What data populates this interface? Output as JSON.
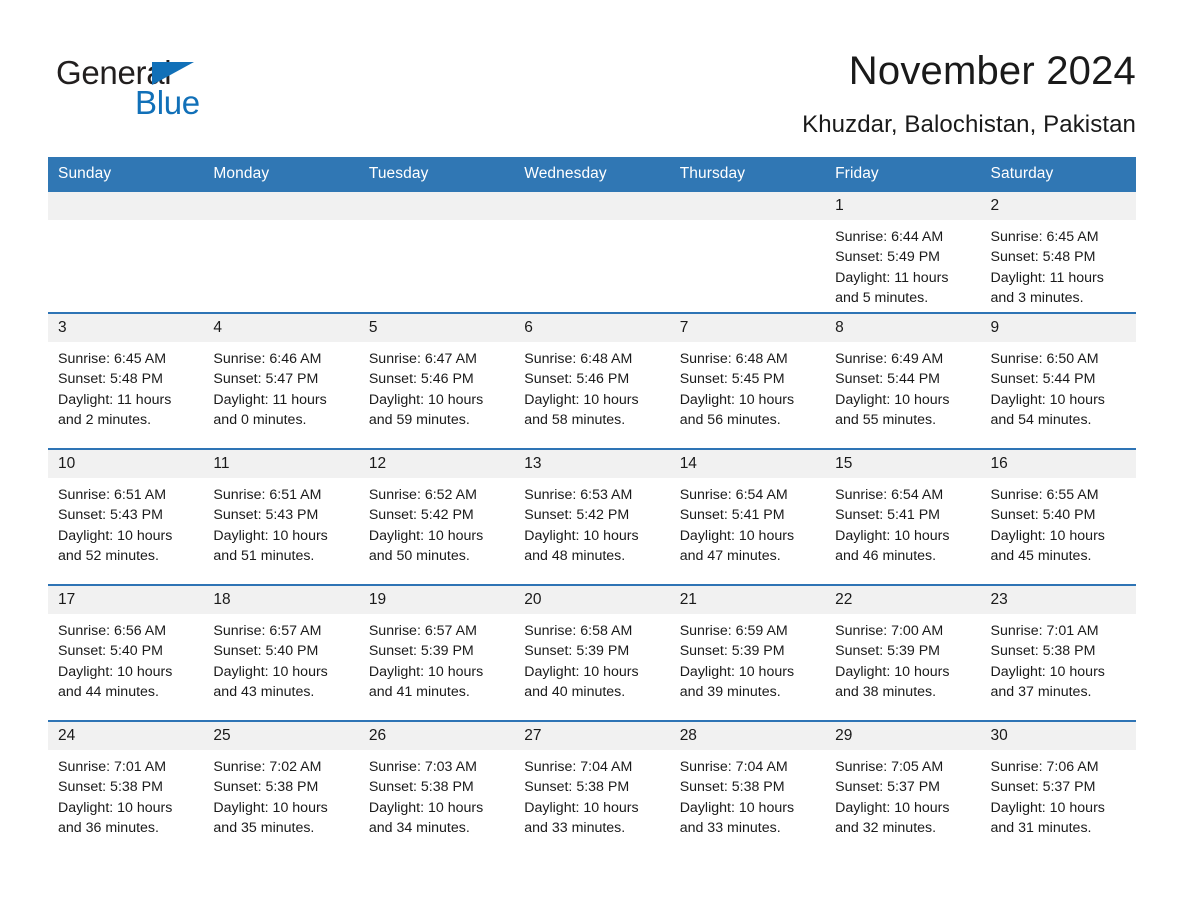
{
  "brand": {
    "name_part1": "General",
    "name_part2": "Blue",
    "accent_color": "#1170b8"
  },
  "header": {
    "title": "November 2024",
    "location": "Khuzdar, Balochistan, Pakistan"
  },
  "theme": {
    "header_blue": "#3077b4",
    "row_divider_blue": "#2e74b5",
    "daynum_band": "#f1f1f1"
  },
  "weekday_headers": [
    "Sunday",
    "Monday",
    "Tuesday",
    "Wednesday",
    "Thursday",
    "Friday",
    "Saturday"
  ],
  "labels": {
    "sunrise_prefix": "Sunrise:",
    "sunset_prefix": "Sunset:",
    "daylight_prefix": "Daylight:"
  },
  "weeks": [
    [
      {
        "date": "",
        "empty": true
      },
      {
        "date": "",
        "empty": true
      },
      {
        "date": "",
        "empty": true
      },
      {
        "date": "",
        "empty": true
      },
      {
        "date": "",
        "empty": true
      },
      {
        "date": "1",
        "sunrise": "Sunrise: 6:44 AM",
        "sunset": "Sunset: 5:49 PM",
        "daylight": "Daylight: 11 hours and 5 minutes."
      },
      {
        "date": "2",
        "sunrise": "Sunrise: 6:45 AM",
        "sunset": "Sunset: 5:48 PM",
        "daylight": "Daylight: 11 hours and 3 minutes."
      }
    ],
    [
      {
        "date": "3",
        "sunrise": "Sunrise: 6:45 AM",
        "sunset": "Sunset: 5:48 PM",
        "daylight": "Daylight: 11 hours and 2 minutes."
      },
      {
        "date": "4",
        "sunrise": "Sunrise: 6:46 AM",
        "sunset": "Sunset: 5:47 PM",
        "daylight": "Daylight: 11 hours and 0 minutes."
      },
      {
        "date": "5",
        "sunrise": "Sunrise: 6:47 AM",
        "sunset": "Sunset: 5:46 PM",
        "daylight": "Daylight: 10 hours and 59 minutes."
      },
      {
        "date": "6",
        "sunrise": "Sunrise: 6:48 AM",
        "sunset": "Sunset: 5:46 PM",
        "daylight": "Daylight: 10 hours and 58 minutes."
      },
      {
        "date": "7",
        "sunrise": "Sunrise: 6:48 AM",
        "sunset": "Sunset: 5:45 PM",
        "daylight": "Daylight: 10 hours and 56 minutes."
      },
      {
        "date": "8",
        "sunrise": "Sunrise: 6:49 AM",
        "sunset": "Sunset: 5:44 PM",
        "daylight": "Daylight: 10 hours and 55 minutes."
      },
      {
        "date": "9",
        "sunrise": "Sunrise: 6:50 AM",
        "sunset": "Sunset: 5:44 PM",
        "daylight": "Daylight: 10 hours and 54 minutes."
      }
    ],
    [
      {
        "date": "10",
        "sunrise": "Sunrise: 6:51 AM",
        "sunset": "Sunset: 5:43 PM",
        "daylight": "Daylight: 10 hours and 52 minutes."
      },
      {
        "date": "11",
        "sunrise": "Sunrise: 6:51 AM",
        "sunset": "Sunset: 5:43 PM",
        "daylight": "Daylight: 10 hours and 51 minutes."
      },
      {
        "date": "12",
        "sunrise": "Sunrise: 6:52 AM",
        "sunset": "Sunset: 5:42 PM",
        "daylight": "Daylight: 10 hours and 50 minutes."
      },
      {
        "date": "13",
        "sunrise": "Sunrise: 6:53 AM",
        "sunset": "Sunset: 5:42 PM",
        "daylight": "Daylight: 10 hours and 48 minutes."
      },
      {
        "date": "14",
        "sunrise": "Sunrise: 6:54 AM",
        "sunset": "Sunset: 5:41 PM",
        "daylight": "Daylight: 10 hours and 47 minutes."
      },
      {
        "date": "15",
        "sunrise": "Sunrise: 6:54 AM",
        "sunset": "Sunset: 5:41 PM",
        "daylight": "Daylight: 10 hours and 46 minutes."
      },
      {
        "date": "16",
        "sunrise": "Sunrise: 6:55 AM",
        "sunset": "Sunset: 5:40 PM",
        "daylight": "Daylight: 10 hours and 45 minutes."
      }
    ],
    [
      {
        "date": "17",
        "sunrise": "Sunrise: 6:56 AM",
        "sunset": "Sunset: 5:40 PM",
        "daylight": "Daylight: 10 hours and 44 minutes."
      },
      {
        "date": "18",
        "sunrise": "Sunrise: 6:57 AM",
        "sunset": "Sunset: 5:40 PM",
        "daylight": "Daylight: 10 hours and 43 minutes."
      },
      {
        "date": "19",
        "sunrise": "Sunrise: 6:57 AM",
        "sunset": "Sunset: 5:39 PM",
        "daylight": "Daylight: 10 hours and 41 minutes."
      },
      {
        "date": "20",
        "sunrise": "Sunrise: 6:58 AM",
        "sunset": "Sunset: 5:39 PM",
        "daylight": "Daylight: 10 hours and 40 minutes."
      },
      {
        "date": "21",
        "sunrise": "Sunrise: 6:59 AM",
        "sunset": "Sunset: 5:39 PM",
        "daylight": "Daylight: 10 hours and 39 minutes."
      },
      {
        "date": "22",
        "sunrise": "Sunrise: 7:00 AM",
        "sunset": "Sunset: 5:39 PM",
        "daylight": "Daylight: 10 hours and 38 minutes."
      },
      {
        "date": "23",
        "sunrise": "Sunrise: 7:01 AM",
        "sunset": "Sunset: 5:38 PM",
        "daylight": "Daylight: 10 hours and 37 minutes."
      }
    ],
    [
      {
        "date": "24",
        "sunrise": "Sunrise: 7:01 AM",
        "sunset": "Sunset: 5:38 PM",
        "daylight": "Daylight: 10 hours and 36 minutes."
      },
      {
        "date": "25",
        "sunrise": "Sunrise: 7:02 AM",
        "sunset": "Sunset: 5:38 PM",
        "daylight": "Daylight: 10 hours and 35 minutes."
      },
      {
        "date": "26",
        "sunrise": "Sunrise: 7:03 AM",
        "sunset": "Sunset: 5:38 PM",
        "daylight": "Daylight: 10 hours and 34 minutes."
      },
      {
        "date": "27",
        "sunrise": "Sunrise: 7:04 AM",
        "sunset": "Sunset: 5:38 PM",
        "daylight": "Daylight: 10 hours and 33 minutes."
      },
      {
        "date": "28",
        "sunrise": "Sunrise: 7:04 AM",
        "sunset": "Sunset: 5:38 PM",
        "daylight": "Daylight: 10 hours and 33 minutes."
      },
      {
        "date": "29",
        "sunrise": "Sunrise: 7:05 AM",
        "sunset": "Sunset: 5:37 PM",
        "daylight": "Daylight: 10 hours and 32 minutes."
      },
      {
        "date": "30",
        "sunrise": "Sunrise: 7:06 AM",
        "sunset": "Sunset: 5:37 PM",
        "daylight": "Daylight: 10 hours and 31 minutes."
      }
    ]
  ]
}
